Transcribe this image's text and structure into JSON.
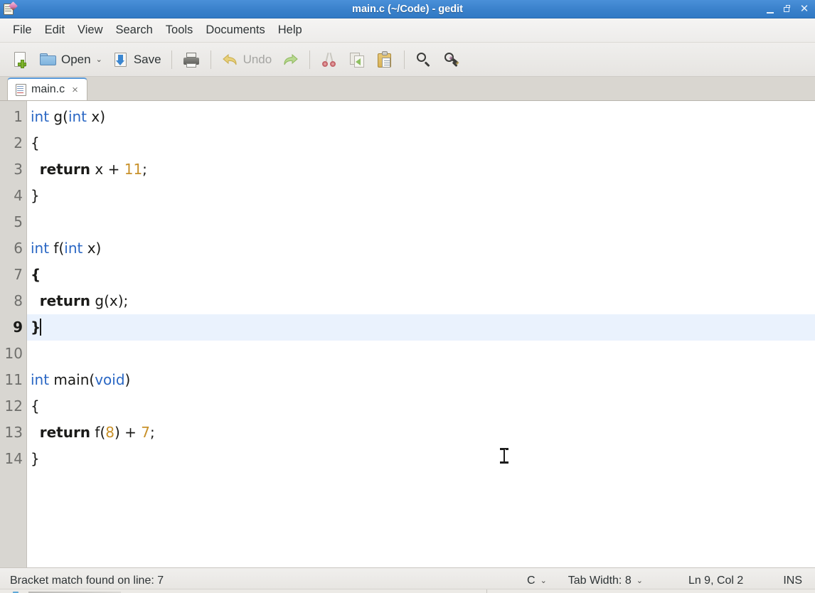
{
  "window": {
    "title": "main.c (~/Code) - gedit",
    "app_icon": "gedit-notepad-pencil-icon",
    "controls": {
      "minimize": "minimize-icon",
      "maximize": "maximize-icon",
      "close": "close-icon"
    }
  },
  "menubar": {
    "items": [
      {
        "label": "File"
      },
      {
        "label": "Edit"
      },
      {
        "label": "View"
      },
      {
        "label": "Search"
      },
      {
        "label": "Tools"
      },
      {
        "label": "Documents"
      },
      {
        "label": "Help"
      }
    ]
  },
  "toolbar": {
    "new_label": "",
    "open_label": "Open",
    "open_dropdown": "⌄",
    "save_label": "Save",
    "print_label": "",
    "undo_label": "Undo",
    "redo_label": "",
    "icons": {
      "new": "new-document-icon",
      "open": "open-folder-icon",
      "save": "save-icon",
      "print": "print-icon",
      "undo": "undo-icon",
      "redo": "redo-icon",
      "cut": "cut-scissors-icon",
      "copy": "copy-icon",
      "paste": "paste-clipboard-icon",
      "find": "find-magnifier-icon",
      "replace": "find-replace-icon"
    }
  },
  "tabs": [
    {
      "title": "main.c",
      "close": "×",
      "icon": "document-icon",
      "active": true
    }
  ],
  "editor": {
    "language": "C",
    "current_line": 9,
    "lines": [
      {
        "n": "1",
        "text": "int g(int x)"
      },
      {
        "n": "2",
        "text": "{"
      },
      {
        "n": "3",
        "text": "  return x + 11;"
      },
      {
        "n": "4",
        "text": "}"
      },
      {
        "n": "5",
        "text": ""
      },
      {
        "n": "6",
        "text": "int f(int x)"
      },
      {
        "n": "7",
        "text": "{"
      },
      {
        "n": "8",
        "text": "  return g(x);"
      },
      {
        "n": "9",
        "text": "}"
      },
      {
        "n": "10",
        "text": ""
      },
      {
        "n": "11",
        "text": "int main(void)"
      },
      {
        "n": "12",
        "text": "{"
      },
      {
        "n": "13",
        "text": "  return f(8) + 7;"
      },
      {
        "n": "14",
        "text": "}"
      }
    ],
    "tokens": {
      "l1_kw": "int",
      "l1_rest_a": " g(",
      "l1_kw2": "int",
      "l1_rest_b": " x)",
      "l2": "{",
      "l3_indent": "  ",
      "l3_kw": "return",
      "l3_mid": " x + ",
      "l3_num": "11",
      "l3_end": ";",
      "l4": "}",
      "l5": "",
      "l6_kw": "int",
      "l6_rest_a": " f(",
      "l6_kw2": "int",
      "l6_rest_b": " x)",
      "l7": "{",
      "l8_indent": "  ",
      "l8_kw": "return",
      "l8_rest": " g(x);",
      "l9": "}",
      "l10": "",
      "l11_kw": "int",
      "l11_mid": " main(",
      "l11_kw2": "void",
      "l11_end": ")",
      "l12": "{",
      "l13_indent": "  ",
      "l13_kw": "return",
      "l13_mid": " f(",
      "l13_num": "8",
      "l13_mid2": ") + ",
      "l13_num2": "7",
      "l13_end": ";",
      "l14": "}"
    },
    "colors": {
      "keyword": "#2a67c4",
      "number": "#c8912a",
      "text": "#1a1a18",
      "current_line_bg": "#eaf2fd",
      "gutter_bg": "#d8d6d1"
    }
  },
  "statusbar": {
    "message": "Bracket match found on line: 7",
    "language": "C",
    "language_dropdown": "⌄",
    "tab_width": "Tab Width: 8",
    "tab_width_dropdown": "⌄",
    "position": "Ln 9, Col 2",
    "insert_mode": "INS"
  },
  "theme": {
    "titlebar": "#3b82cc",
    "tab_accent": "#5b9ad9",
    "chrome": "#ecebe9"
  }
}
